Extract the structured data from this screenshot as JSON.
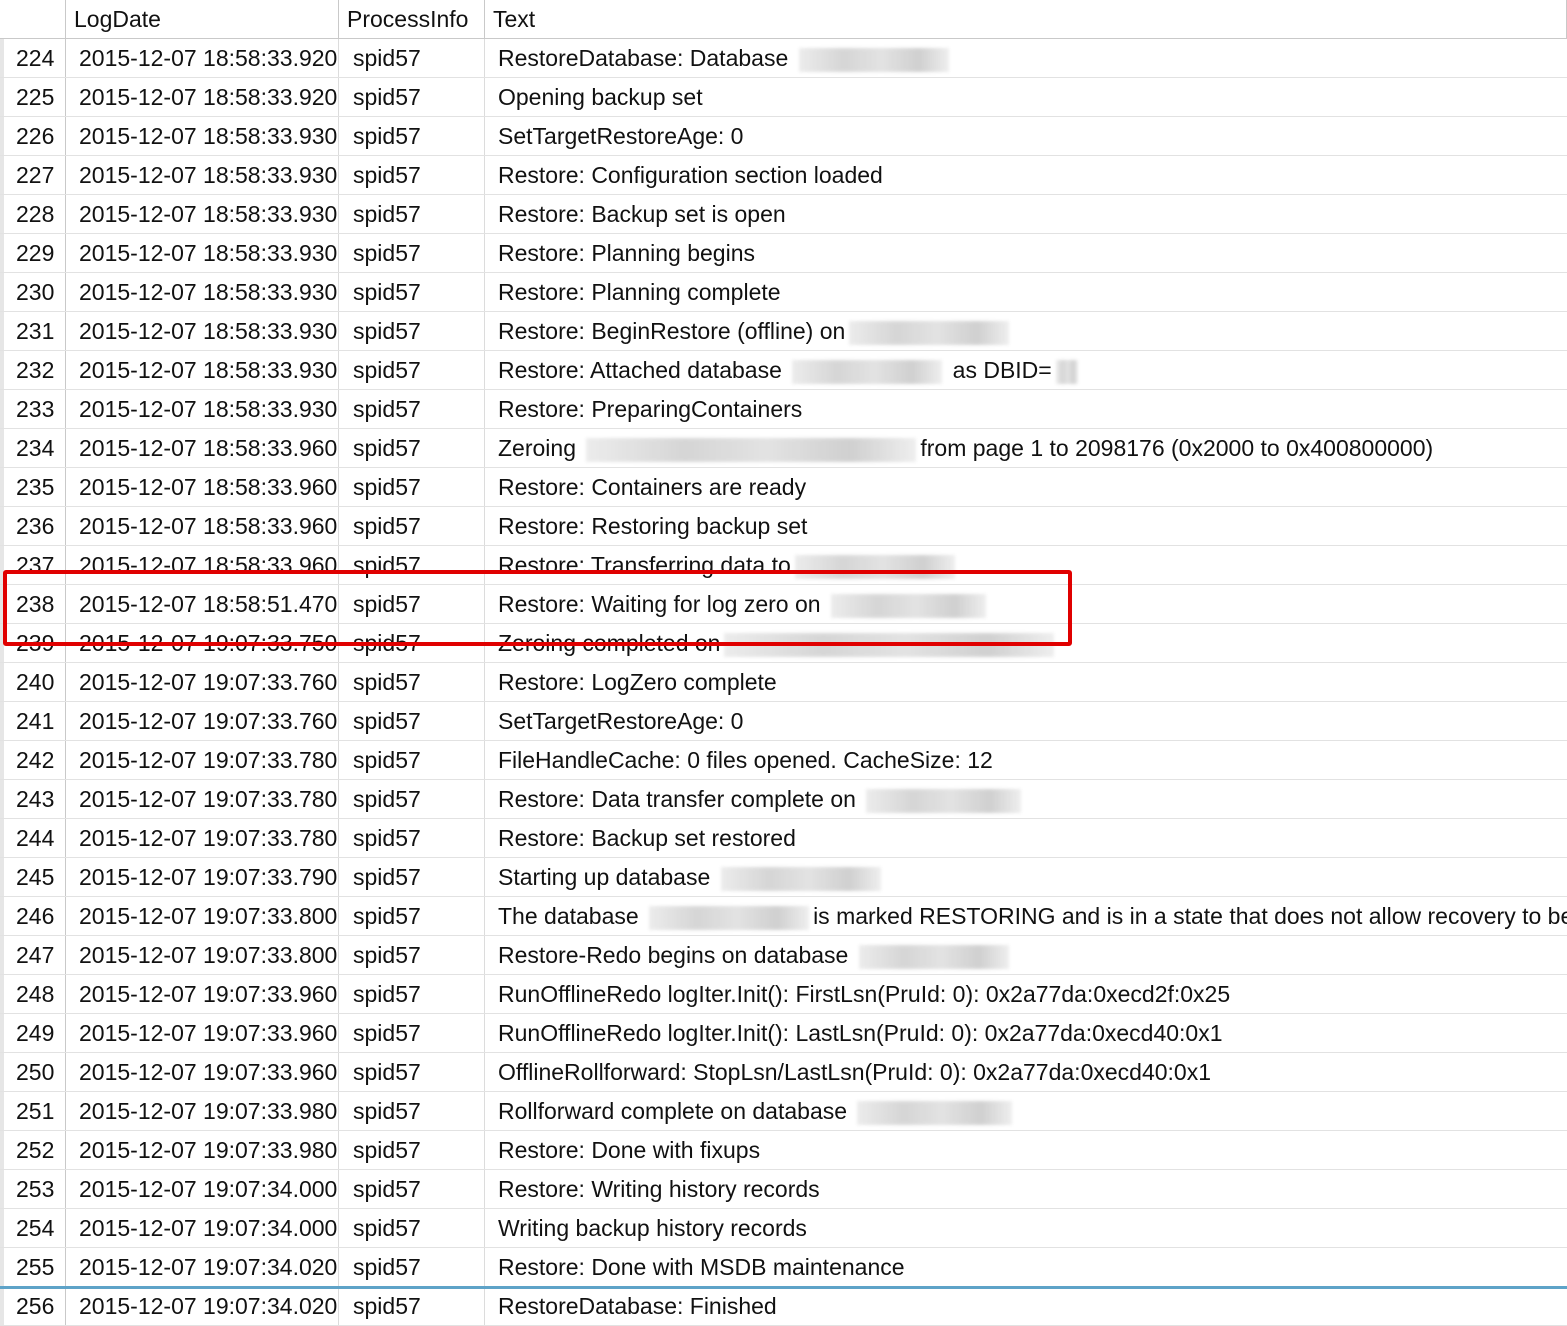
{
  "columns": [
    "",
    "LogDate",
    "ProcessInfo",
    "Text"
  ],
  "rows": [
    {
      "n": "224",
      "date": "2015-12-07 18:58:33.920",
      "proc": "spid57",
      "parts": [
        "RestoreDatabase: Database ",
        {
          "blur": 150
        }
      ]
    },
    {
      "n": "225",
      "date": "2015-12-07 18:58:33.920",
      "proc": "spid57",
      "parts": [
        "Opening backup set"
      ]
    },
    {
      "n": "226",
      "date": "2015-12-07 18:58:33.930",
      "proc": "spid57",
      "parts": [
        "SetTargetRestoreAge: 0"
      ]
    },
    {
      "n": "227",
      "date": "2015-12-07 18:58:33.930",
      "proc": "spid57",
      "parts": [
        "Restore: Configuration section loaded"
      ]
    },
    {
      "n": "228",
      "date": "2015-12-07 18:58:33.930",
      "proc": "spid57",
      "parts": [
        "Restore: Backup set is open"
      ]
    },
    {
      "n": "229",
      "date": "2015-12-07 18:58:33.930",
      "proc": "spid57",
      "parts": [
        "Restore: Planning begins"
      ]
    },
    {
      "n": "230",
      "date": "2015-12-07 18:58:33.930",
      "proc": "spid57",
      "parts": [
        "Restore: Planning complete"
      ]
    },
    {
      "n": "231",
      "date": "2015-12-07 18:58:33.930",
      "proc": "spid57",
      "parts": [
        "Restore: BeginRestore (offline) on",
        {
          "blur": 160
        }
      ]
    },
    {
      "n": "232",
      "date": "2015-12-07 18:58:33.930",
      "proc": "spid57",
      "parts": [
        "Restore: Attached database ",
        {
          "blur": 150
        },
        " as DBID=",
        {
          "blur": 22
        }
      ]
    },
    {
      "n": "233",
      "date": "2015-12-07 18:58:33.930",
      "proc": "spid57",
      "parts": [
        "Restore: PreparingContainers"
      ]
    },
    {
      "n": "234",
      "date": "2015-12-07 18:58:33.960",
      "proc": "spid57",
      "parts": [
        "Zeroing ",
        {
          "blur": 330
        },
        "from page 1 to 2098176 (0x2000 to 0x400800000)"
      ]
    },
    {
      "n": "235",
      "date": "2015-12-07 18:58:33.960",
      "proc": "spid57",
      "parts": [
        "Restore: Containers are ready"
      ]
    },
    {
      "n": "236",
      "date": "2015-12-07 18:58:33.960",
      "proc": "spid57",
      "parts": [
        "Restore: Restoring backup set"
      ]
    },
    {
      "n": "237",
      "date": "2015-12-07 18:58:33.960",
      "proc": "spid57",
      "parts": [
        "Restore: Transferring data to",
        {
          "blur": 160
        }
      ]
    },
    {
      "n": "238",
      "date": "2015-12-07 18:58:51.470",
      "proc": "spid57",
      "parts": [
        "Restore: Waiting for log zero on ",
        {
          "blur": 155
        }
      ]
    },
    {
      "n": "239",
      "date": "2015-12-07 19:07:33.750",
      "proc": "spid57",
      "parts": [
        "Zeroing completed on",
        {
          "blur": 330
        }
      ]
    },
    {
      "n": "240",
      "date": "2015-12-07 19:07:33.760",
      "proc": "spid57",
      "parts": [
        "Restore: LogZero complete"
      ]
    },
    {
      "n": "241",
      "date": "2015-12-07 19:07:33.760",
      "proc": "spid57",
      "parts": [
        "SetTargetRestoreAge: 0"
      ]
    },
    {
      "n": "242",
      "date": "2015-12-07 19:07:33.780",
      "proc": "spid57",
      "parts": [
        "FileHandleCache: 0 files opened. CacheSize: 12"
      ]
    },
    {
      "n": "243",
      "date": "2015-12-07 19:07:33.780",
      "proc": "spid57",
      "parts": [
        "Restore: Data transfer complete on ",
        {
          "blur": 155
        }
      ]
    },
    {
      "n": "244",
      "date": "2015-12-07 19:07:33.780",
      "proc": "spid57",
      "parts": [
        "Restore: Backup set restored"
      ]
    },
    {
      "n": "245",
      "date": "2015-12-07 19:07:33.790",
      "proc": "spid57",
      "parts": [
        "Starting up database ",
        {
          "blur": 160
        }
      ]
    },
    {
      "n": "246",
      "date": "2015-12-07 19:07:33.800",
      "proc": "spid57",
      "parts": [
        "The database ",
        {
          "blur": 160
        },
        "is marked RESTORING and is in a state that does not allow recovery to be run."
      ]
    },
    {
      "n": "247",
      "date": "2015-12-07 19:07:33.800",
      "proc": "spid57",
      "parts": [
        "Restore-Redo begins on database ",
        {
          "blur": 150
        }
      ]
    },
    {
      "n": "248",
      "date": "2015-12-07 19:07:33.960",
      "proc": "spid57",
      "parts": [
        "RunOfflineRedo logIter.Init(): FirstLsn(PruId: 0): 0x2a77da:0xecd2f:0x25"
      ]
    },
    {
      "n": "249",
      "date": "2015-12-07 19:07:33.960",
      "proc": "spid57",
      "parts": [
        "RunOfflineRedo logIter.Init(): LastLsn(PruId: 0): 0x2a77da:0xecd40:0x1"
      ]
    },
    {
      "n": "250",
      "date": "2015-12-07 19:07:33.960",
      "proc": "spid57",
      "parts": [
        "OfflineRollforward: StopLsn/LastLsn(PruId: 0): 0x2a77da:0xecd40:0x1"
      ]
    },
    {
      "n": "251",
      "date": "2015-12-07 19:07:33.980",
      "proc": "spid57",
      "parts": [
        "Rollforward complete on database ",
        {
          "blur": 155
        }
      ]
    },
    {
      "n": "252",
      "date": "2015-12-07 19:07:33.980",
      "proc": "spid57",
      "parts": [
        "Restore: Done with fixups"
      ]
    },
    {
      "n": "253",
      "date": "2015-12-07 19:07:34.000",
      "proc": "spid57",
      "parts": [
        "Restore: Writing history records"
      ]
    },
    {
      "n": "254",
      "date": "2015-12-07 19:07:34.000",
      "proc": "spid57",
      "parts": [
        "Writing backup history records"
      ]
    },
    {
      "n": "255",
      "date": "2015-12-07 19:07:34.020",
      "proc": "spid57",
      "parts": [
        "Restore: Done with MSDB maintenance"
      ]
    },
    {
      "n": "256",
      "date": "2015-12-07 19:07:34.020",
      "proc": "spid57",
      "parts": [
        "RestoreDatabase: Finished"
      ]
    }
  ],
  "highlight": {
    "rows": [
      "238",
      "239"
    ],
    "color": "#e00000"
  }
}
